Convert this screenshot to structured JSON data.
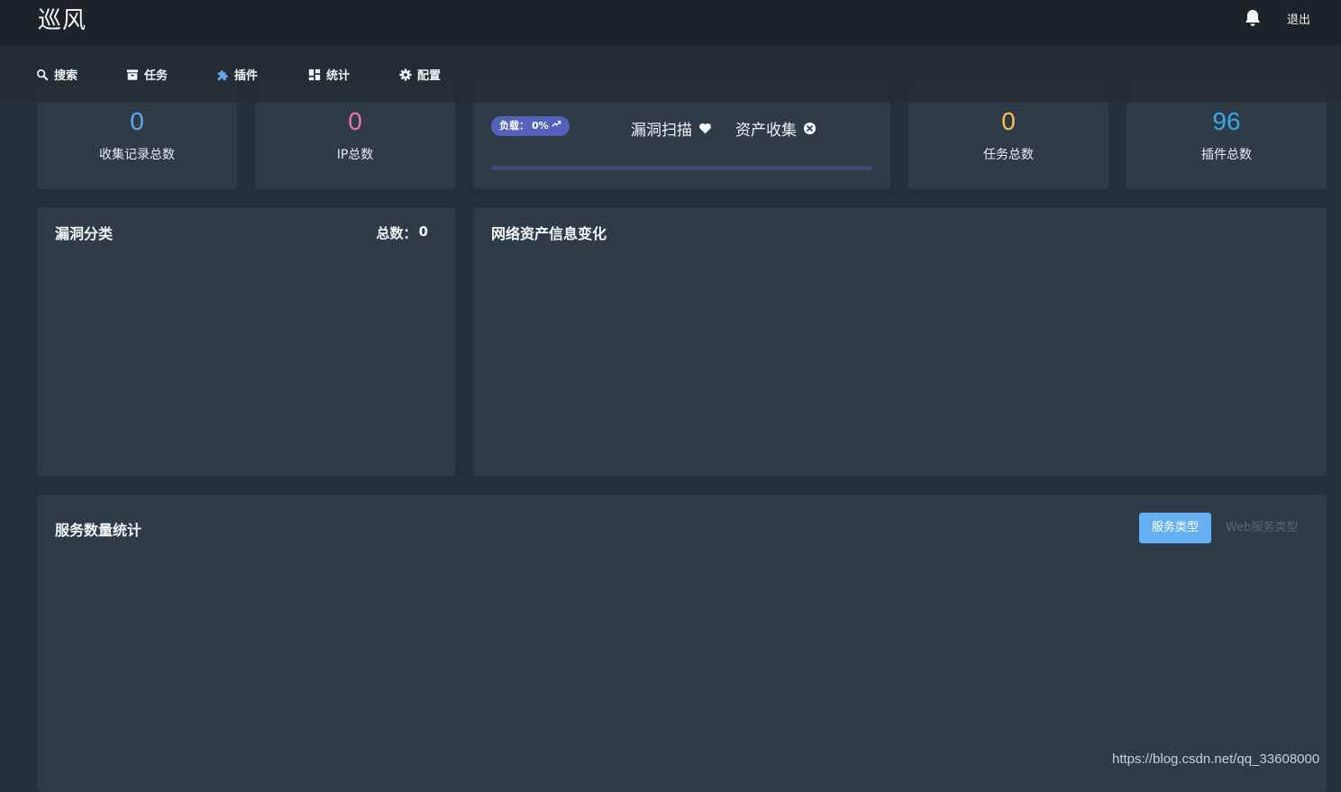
{
  "app": {
    "logo": "巡风"
  },
  "header": {
    "logout_label": "退出"
  },
  "nav": {
    "items": [
      {
        "label": "搜索",
        "icon": "search-icon",
        "color": "#f2f4f6"
      },
      {
        "label": "任务",
        "icon": "archive-icon",
        "color": "#f2f4f6"
      },
      {
        "label": "插件",
        "icon": "puzzle-icon",
        "color": "#5aa9f2"
      },
      {
        "label": "统计",
        "icon": "dashboard-icon",
        "color": "#f2f4f6"
      },
      {
        "label": "配置",
        "icon": "gear-icon",
        "color": "#f2f4f6"
      }
    ]
  },
  "stats": {
    "records": {
      "value": "0",
      "label": "收集记录总数",
      "color": "#5aa9f2"
    },
    "ips": {
      "value": "0",
      "label": "IP总数",
      "color": "#ef6fb6"
    },
    "tasks": {
      "value": "0",
      "label": "任务总数",
      "color": "#f4c24a"
    },
    "plugins": {
      "value": "96",
      "label": "插件总数",
      "color": "#37a8ea"
    }
  },
  "status": {
    "load_label": "负载：",
    "load_value": "0%",
    "load_fraction": 0,
    "vuln_scan_label": "漏洞扫描",
    "asset_collect_label": "资产收集",
    "vuln_scan_icon": "heart-icon",
    "asset_collect_icon": "close-circle-icon"
  },
  "panels": {
    "vuln": {
      "title": "漏洞分类",
      "total_label": "总数：",
      "total_value": "0"
    },
    "network": {
      "title": "网络资产信息变化"
    },
    "service": {
      "title": "服务数量统计",
      "tab_active": "服务类型",
      "tab_other": "Web服务类型"
    }
  },
  "watermark": "https://blog.csdn.net/qq_33608000"
}
